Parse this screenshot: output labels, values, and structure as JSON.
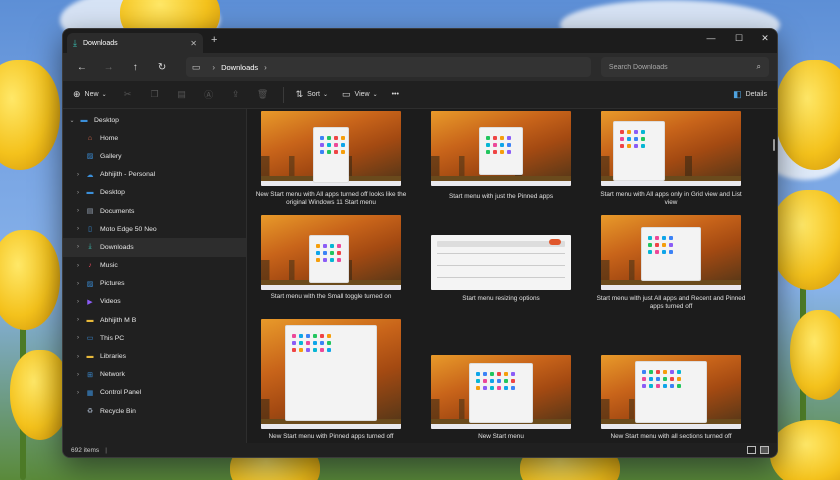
{
  "window": {
    "tab_title": "Downloads",
    "tab_close": "✕",
    "new_tab": "+",
    "minimize": "—",
    "maximize": "☐",
    "close": "✕"
  },
  "navbar": {
    "back": "←",
    "forward": "→",
    "up": "↑",
    "refresh": "↻",
    "breadcrumb": [
      "Downloads"
    ],
    "search_placeholder": "Search Downloads"
  },
  "toolbar": {
    "new_label": "New",
    "sort_label": "Sort",
    "view_label": "View",
    "more_label": "•••",
    "details_label": "Details"
  },
  "sidebar": {
    "items": [
      {
        "label": "Desktop",
        "icon": "desktop-icon",
        "color": "#3b8fd9",
        "chev": "⌄",
        "indent": 0
      },
      {
        "label": "Home",
        "icon": "home-icon",
        "color": "#e06b4e",
        "chev": "",
        "indent": 1
      },
      {
        "label": "Gallery",
        "icon": "gallery-icon",
        "color": "#3b8fd9",
        "chev": "",
        "indent": 1
      },
      {
        "label": "Abhijith - Personal",
        "icon": "cloud-icon",
        "color": "#3b8fd9",
        "chev": "›",
        "indent": 1
      },
      {
        "label": "Desktop",
        "icon": "desktop-icon",
        "color": "#3b8fd9",
        "chev": "›",
        "indent": 1
      },
      {
        "label": "Documents",
        "icon": "documents-icon",
        "color": "#9aa7b8",
        "chev": "›",
        "indent": 1
      },
      {
        "label": "Moto Edge 50 Neo",
        "icon": "phone-icon",
        "color": "#3b8fd9",
        "chev": "›",
        "indent": 1
      },
      {
        "label": "Downloads",
        "icon": "download-icon",
        "color": "#3ac1b3",
        "chev": "›",
        "indent": 1,
        "active": true
      },
      {
        "label": "Music",
        "icon": "music-icon",
        "color": "#e0495b",
        "chev": "›",
        "indent": 1
      },
      {
        "label": "Pictures",
        "icon": "pictures-icon",
        "color": "#3b8fd9",
        "chev": "›",
        "indent": 1
      },
      {
        "label": "Videos",
        "icon": "videos-icon",
        "color": "#8b5cf6",
        "chev": "›",
        "indent": 1
      },
      {
        "label": "Abhijith M B",
        "icon": "folder-icon",
        "color": "#e8b93a",
        "chev": "›",
        "indent": 1
      },
      {
        "label": "This PC",
        "icon": "pc-icon",
        "color": "#3b8fd9",
        "chev": "›",
        "indent": 1
      },
      {
        "label": "Libraries",
        "icon": "folder-icon",
        "color": "#e8b93a",
        "chev": "›",
        "indent": 1
      },
      {
        "label": "Network",
        "icon": "network-icon",
        "color": "#3b8fd9",
        "chev": "›",
        "indent": 1
      },
      {
        "label": "Control Panel",
        "icon": "control-panel-icon",
        "color": "#3b8fd9",
        "chev": "›",
        "indent": 1
      },
      {
        "label": "Recycle Bin",
        "icon": "recycle-bin-icon",
        "color": "#9aa7b8",
        "chev": "",
        "indent": 1
      }
    ]
  },
  "files": [
    {
      "caption": "New Start menu with All apps turned off looks like the original Windows 11 Start menu"
    },
    {
      "caption": "Start menu with just the Pinned apps"
    },
    {
      "caption": "Start menu with All apps only in Grid view and List view"
    },
    {
      "caption": "Start menu with the Small toggle turned on"
    },
    {
      "caption": "Start menu resizing options"
    },
    {
      "caption": "Start menu with just All apps and Recent and Pinned apps turned off"
    },
    {
      "caption": "New Start menu with Pinned apps turned off"
    },
    {
      "caption": "New Start menu"
    },
    {
      "caption": "New Start menu with all sections turned off"
    }
  ],
  "status": {
    "item_count": "692 items",
    "separator": "|"
  }
}
